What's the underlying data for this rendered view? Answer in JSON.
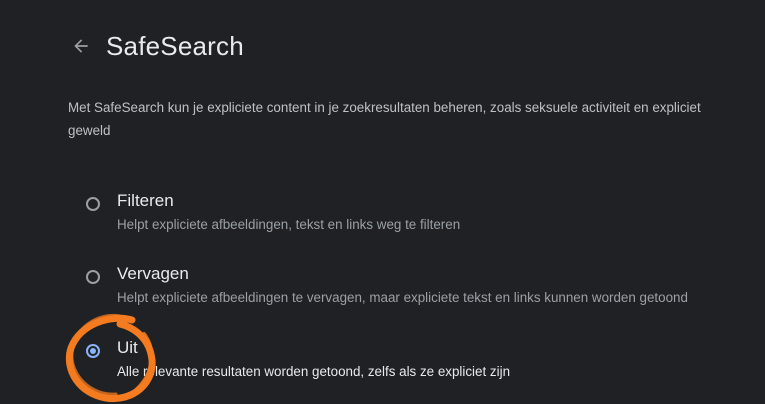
{
  "header": {
    "back_icon": "arrow-back-icon",
    "title": "SafeSearch"
  },
  "description": "Met SafeSearch kun je expliciete content in je zoekresultaten beheren, zoals seksuele activiteit en expliciet geweld",
  "options": [
    {
      "label": "Filteren",
      "description": "Helpt expliciete afbeeldingen, tekst en links weg te filteren",
      "selected": false
    },
    {
      "label": "Vervagen",
      "description": "Helpt expliciete afbeeldingen te vervagen, maar expliciete tekst en links kunnen worden getoond",
      "selected": false
    },
    {
      "label": "Uit",
      "description": "Alle relevante resultaten worden getoond, zelfs als ze expliciet zijn",
      "selected": true
    }
  ],
  "colors": {
    "background": "#202124",
    "accent": "#8ab4f8",
    "highlight_ring": "#f47b20"
  }
}
